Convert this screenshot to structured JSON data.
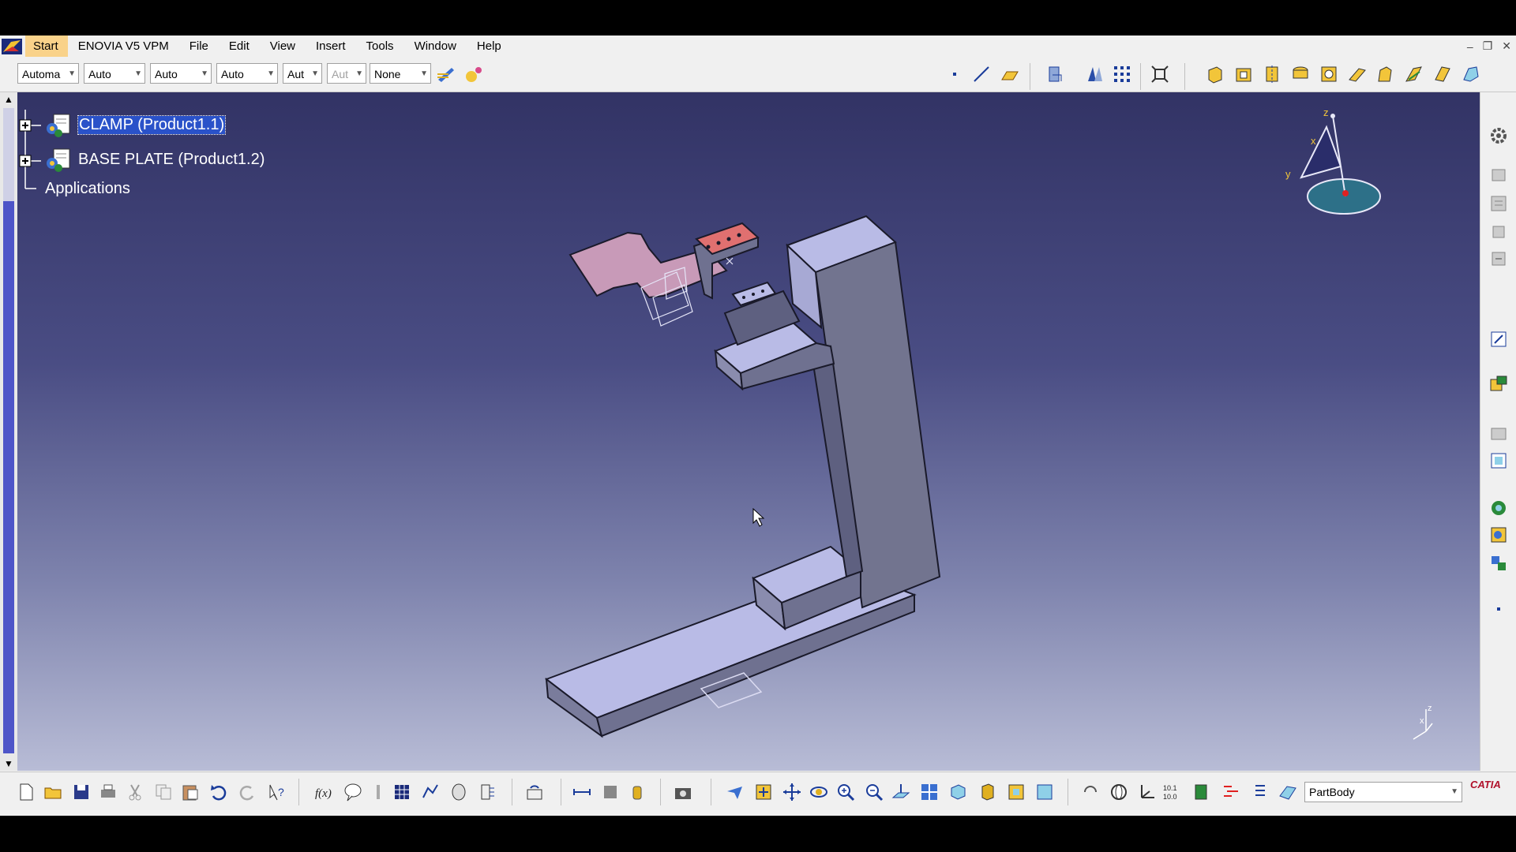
{
  "menu": {
    "items": [
      {
        "name": "menu-start",
        "label": "Start"
      },
      {
        "name": "menu-enovia",
        "label": "ENOVIA V5 VPM"
      },
      {
        "name": "menu-file",
        "label": "File"
      },
      {
        "name": "menu-edit",
        "label": "Edit"
      },
      {
        "name": "menu-view",
        "label": "View"
      },
      {
        "name": "menu-insert",
        "label": "Insert"
      },
      {
        "name": "menu-tools",
        "label": "Tools"
      },
      {
        "name": "menu-window",
        "label": "Window"
      },
      {
        "name": "menu-help",
        "label": "Help"
      }
    ],
    "window_controls": {
      "minimize": "–",
      "restore": "❐",
      "close": "✕"
    }
  },
  "toolbar_top": {
    "color_combo": "Automa",
    "transparency_combo": "Auto",
    "linetype_combo": "Auto",
    "thickness_combo": "Auto",
    "point_combo": "Aut",
    "layer_combo": "Aut",
    "render_combo": "None"
  },
  "tree": {
    "nodes": [
      {
        "label": "CLAMP (Product1.1)"
      },
      {
        "label": "BASE PLATE (Product1.2)"
      },
      {
        "label": "Applications"
      }
    ]
  },
  "compass": {
    "x": "x",
    "y": "y",
    "z": "z"
  },
  "small_axis": {
    "x": "x",
    "z": "z"
  },
  "toolbar_bottom": {
    "current_body": "PartBody",
    "brand": "CATIA"
  },
  "colors": {
    "viewport_top": "#323365",
    "viewport_bottom": "#b8bcd6",
    "part_face": "#b9bbe6",
    "part_side": "#6f7190",
    "clamp_face": "#c89ab8",
    "clamp_tip": "#e07070",
    "selection": "#2a52c9"
  }
}
